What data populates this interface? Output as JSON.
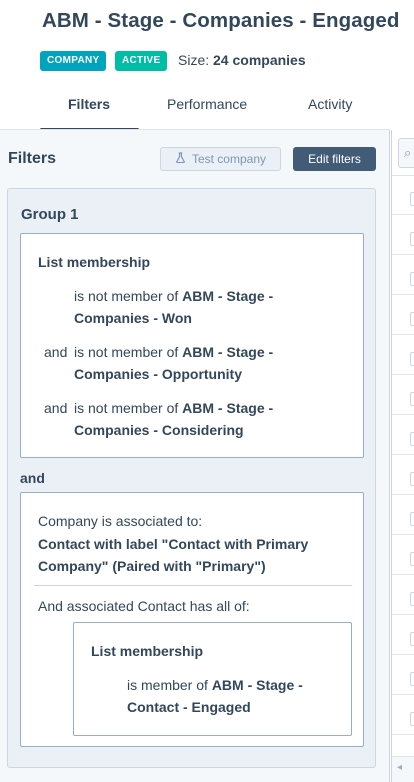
{
  "header": {
    "title": "ABM - Stage - Companies - Engaged",
    "badges": {
      "type": "COMPANY",
      "status": "ACTIVE"
    },
    "size_label": "Size:",
    "size_value": "24 companies"
  },
  "tabs": [
    {
      "label": "Filters"
    },
    {
      "label": "Performance"
    },
    {
      "label": "Activity"
    }
  ],
  "filters": {
    "title": "Filters",
    "test_button": "Test company",
    "edit_button": "Edit filters",
    "group": {
      "title": "Group 1",
      "list_membership": {
        "heading": "List membership",
        "rules": [
          {
            "conj": "",
            "pre": "is not member of ",
            "name1": "ABM - Stage -",
            "name2": "Companies - Won"
          },
          {
            "conj": "and",
            "pre": "is not member of ",
            "name1": "ABM - Stage -",
            "name2": "Companies - Opportunity"
          },
          {
            "conj": "and",
            "pre": "is not member of ",
            "name1": "ABM - Stage -",
            "name2": "Companies - Considering"
          }
        ]
      },
      "and_label": "and",
      "association": {
        "line1": "Company is associated to:",
        "line2": "Contact with label \"Contact with Primary Company\" (Paired with \"Primary\")",
        "line3": "And associated Contact has all of:",
        "nested": {
          "heading": "List membership",
          "pre": "is member of ",
          "name1": "ABM - Stage -",
          "name2": "Contact - Engaged"
        }
      }
    }
  },
  "colors": {
    "text": "#33475b",
    "company_badge": "#00a4bd",
    "active_badge": "#00bda5",
    "edit_button": "#425b76",
    "panel_bg": "#f5f8fa"
  },
  "icons": {
    "test_button_icon": "flask-icon",
    "search": "search-icon"
  }
}
